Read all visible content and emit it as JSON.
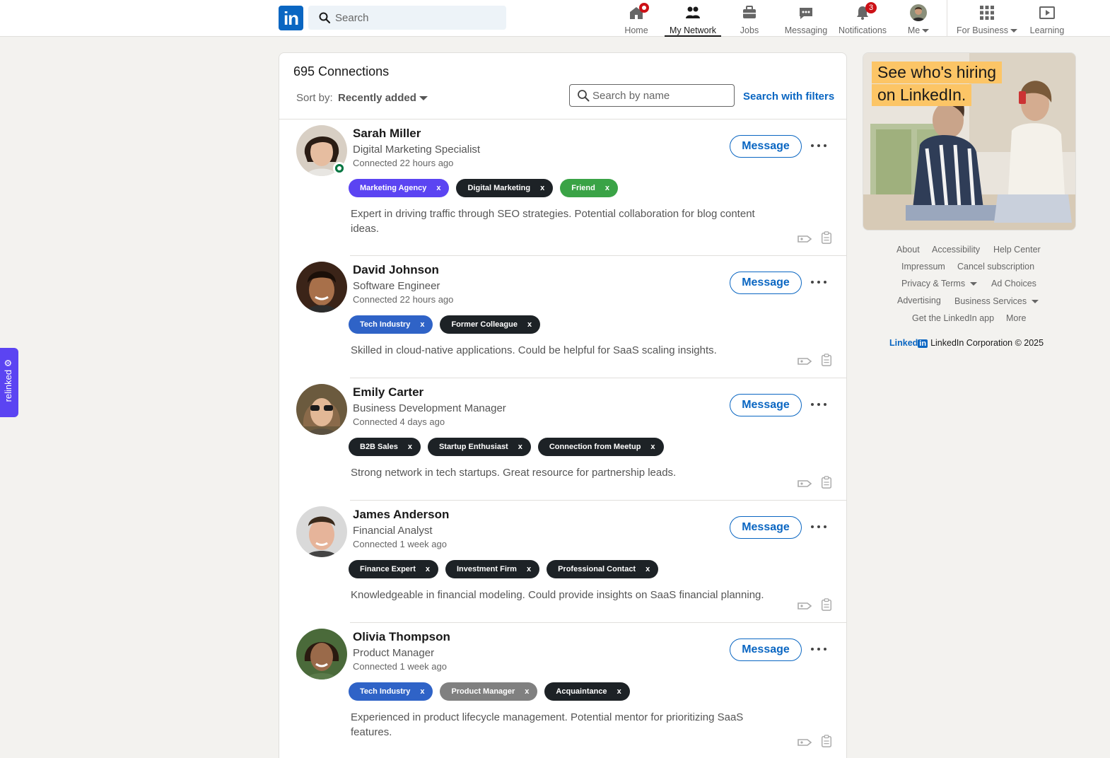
{
  "nav": {
    "search_placeholder": "Search",
    "items": [
      {
        "label": "Home",
        "icon": "home-icon"
      },
      {
        "label": "My Network",
        "icon": "network-icon",
        "active": true
      },
      {
        "label": "Jobs",
        "icon": "briefcase-icon"
      },
      {
        "label": "Messaging",
        "icon": "chat-icon"
      },
      {
        "label": "Notifications",
        "icon": "bell-icon",
        "badge": "3"
      },
      {
        "label": "Me",
        "icon": "avatar"
      },
      {
        "label": "For Business",
        "icon": "grid-icon"
      },
      {
        "label": "Learning",
        "icon": "play-icon"
      }
    ]
  },
  "connections": {
    "count_label": "695 Connections",
    "sort_label": "Sort by:",
    "sort_value": "Recently added",
    "search_placeholder": "Search by name",
    "filters_link": "Search with filters",
    "message_label": "Message",
    "people": [
      {
        "name": "Sarah Miller",
        "title": "Digital Marketing Specialist",
        "connected": "Connected 22 hours ago",
        "online": true,
        "tags": [
          {
            "label": "Marketing Agency",
            "color": "#5b44f2"
          },
          {
            "label": "Digital Marketing",
            "color": "#1d2226"
          },
          {
            "label": "Friend",
            "color": "#3aa346"
          }
        ],
        "note": "Expert in driving traffic through SEO strategies. Potential collaboration for blog content ideas."
      },
      {
        "name": "David Johnson",
        "title": "Software Engineer",
        "connected": "Connected 22 hours ago",
        "tags": [
          {
            "label": "Tech Industry",
            "color": "#2f63c7"
          },
          {
            "label": "Former Colleague",
            "color": "#1d2226"
          }
        ],
        "note": "Skilled in cloud-native applications. Could be helpful for SaaS scaling insights."
      },
      {
        "name": "Emily Carter",
        "title": "Business Development Manager",
        "connected": "Connected 4 days ago",
        "tags": [
          {
            "label": "B2B Sales",
            "color": "#1d2226"
          },
          {
            "label": "Startup Enthusiast",
            "color": "#1d2226"
          },
          {
            "label": "Connection from Meetup",
            "color": "#1d2226"
          }
        ],
        "note": "Strong network in tech startups. Great resource for partnership leads."
      },
      {
        "name": "James Anderson",
        "title": "Financial Analyst",
        "connected": "Connected 1 week ago",
        "tags": [
          {
            "label": "Finance Expert",
            "color": "#1d2226"
          },
          {
            "label": "Investment Firm",
            "color": "#1d2226"
          },
          {
            "label": "Professional Contact",
            "color": "#1d2226"
          }
        ],
        "note": "Knowledgeable in financial modeling. Could provide insights on SaaS financial planning."
      },
      {
        "name": "Olivia Thompson",
        "title": "Product Manager",
        "connected": "Connected 1 week ago",
        "tags": [
          {
            "label": "Tech Industry",
            "color": "#2f63c7"
          },
          {
            "label": "Product Manager",
            "color": "#808080"
          },
          {
            "label": "Acquaintance",
            "color": "#1d2226"
          }
        ],
        "note": "Experienced in product lifecycle management. Potential mentor for prioritizing SaaS features."
      }
    ]
  },
  "ad": {
    "line1": "See who's hiring",
    "line2": "on LinkedIn."
  },
  "footer": {
    "links": [
      "About",
      "Accessibility",
      "Help Center",
      "Impressum",
      "Cancel subscription",
      "Privacy & Terms",
      "Ad Choices",
      "Advertising",
      "Business Services",
      "Get the LinkedIn app",
      "More"
    ],
    "brand": "Linked",
    "brand_in": "in",
    "corp": "LinkedIn Corporation © 2025"
  },
  "relinked": {
    "label": "relinked ⚙"
  }
}
